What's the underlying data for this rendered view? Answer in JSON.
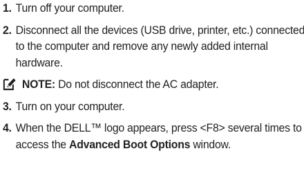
{
  "steps": [
    {
      "num": "1.",
      "text": "Turn off your computer."
    },
    {
      "num": "2.",
      "text": "Disconnect all the devices (USB drive, printer, etc.) connected to the computer and remove any newly added internal hardware."
    },
    {
      "num": "3.",
      "text": "Turn on your computer."
    },
    {
      "num": "4.",
      "text_before": "When the DELL™ logo appears, press <F8> several times to access the ",
      "bold": "Advanced Boot Options",
      "text_after": " window."
    }
  ],
  "note": {
    "icon": "pencil-note-icon",
    "label": "NOTE:",
    "text": " Do not disconnect the AC adapter."
  }
}
